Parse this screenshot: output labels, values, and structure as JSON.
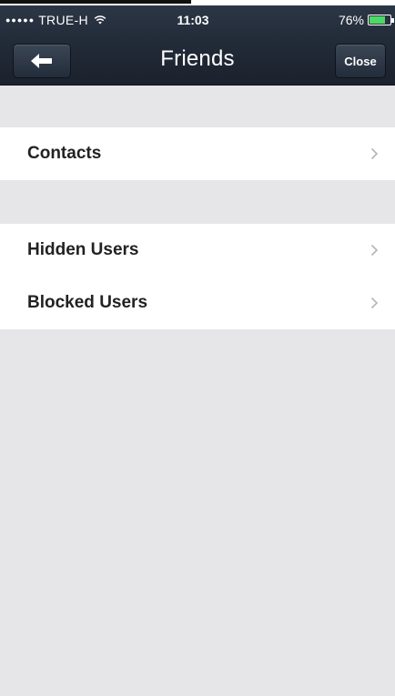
{
  "status_bar": {
    "signal_dots": "●●●●●",
    "carrier": "TRUE-H",
    "wifi_icon": "wifi-icon",
    "time": "11:03",
    "battery": "76%"
  },
  "nav": {
    "title": "Friends",
    "back_icon": "back-arrow-icon",
    "close_label": "Close"
  },
  "sections": [
    {
      "items": [
        {
          "label": "Contacts"
        }
      ]
    },
    {
      "items": [
        {
          "label": "Hidden Users"
        },
        {
          "label": "Blocked Users"
        }
      ]
    }
  ],
  "colors": {
    "header_dark": "#222b38",
    "background": "#e6e6e8",
    "battery_fill": "#4cd964"
  }
}
